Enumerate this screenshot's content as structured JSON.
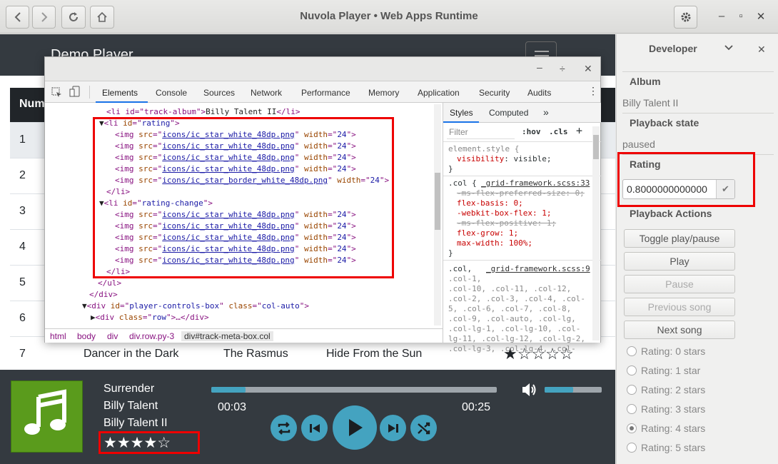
{
  "window": {
    "title": "Nuvola Player • Web Apps Runtime"
  },
  "app": {
    "brand": "Demo Player",
    "table": {
      "header": "Num",
      "rows": [
        {
          "num": "1",
          "song": "",
          "artist": "",
          "album": "",
          "stars": "",
          "selected": true
        },
        {
          "num": "2",
          "song": "",
          "artist": "",
          "album": "",
          "stars": ""
        },
        {
          "num": "3",
          "song": "",
          "artist": "",
          "album": "",
          "stars": ""
        },
        {
          "num": "4",
          "song": "",
          "artist": "",
          "album": "",
          "stars": ""
        },
        {
          "num": "5",
          "song": "",
          "artist": "",
          "album": "",
          "stars": ""
        },
        {
          "num": "6",
          "song": "",
          "artist": "",
          "album": "",
          "stars": ""
        },
        {
          "num": "7",
          "song": "Dancer in the Dark",
          "artist": "The Rasmus",
          "album": "Hide From the Sun",
          "stars": "★☆☆☆☆"
        }
      ]
    },
    "player": {
      "title": "Surrender",
      "artist": "Billy Talent",
      "album": "Billy Talent II",
      "stars": "★★★★☆",
      "elapsed": "00:03",
      "duration": "00:25",
      "progress": 0.12,
      "volume": 0.5
    }
  },
  "devtools": {
    "tabs": [
      "Elements",
      "Console",
      "Sources",
      "Network",
      "Performance",
      "Memory",
      "Application",
      "Security",
      "Audits"
    ],
    "active_tab": "Elements",
    "style_tabs": [
      "Styles",
      "Computed",
      "»"
    ],
    "filter_placeholder": "Filter",
    "hov": ":hov",
    "cls": ".cls",
    "breadcrumbs": [
      "html",
      "body",
      "div",
      "div.row.py-3",
      "div#track-meta-box.col"
    ],
    "dom": {
      "track_album_open": "<li id=\"track-album\">",
      "track_album_text": "Billy Talent II",
      "track_album_close": "</li>",
      "rating_open_id": "rating",
      "rating_change_id": "rating-change",
      "img_src_full": "icons/ic_star_white_48dp.png",
      "img_src_border": "icons/ic_star_border_white_48dp.png",
      "width": "24",
      "li_close": "</li>",
      "ul_close": "</ul>",
      "div_close": "</div>",
      "player_controls_id": "player-controls-box",
      "player_controls_class": "col-auto",
      "row_class": "row"
    },
    "styles": {
      "element_style": "element.style {",
      "visibility": "visibility: visible;",
      "close": "}",
      "col_selector": ".col {",
      "col_source": "_grid-framework.scss:33",
      "props": [
        "-ms-flex-preferred-size: 0;",
        "flex-basis: 0;",
        "-webkit-box-flex: 1;",
        "-ms-flex-positive: 1;",
        "flex-grow: 1;",
        "max-width: 100%;"
      ],
      "col2_selector": ".col,",
      "col2_source": "_grid-framework.scss:9",
      "col2_list": [
        ".col-1,",
        ".col-10, .col-11, .col-12,",
        ".col-2, .col-3, .col-4, .col-",
        "5, .col-6, .col-7, .col-8,",
        ".col-9, .col-auto, .col-lg,",
        ".col-lg-1, .col-lg-10, .col-",
        "lg-11, .col-lg-12, .col-lg-2,",
        ".col-lg-3, .col-lg-4, .col-"
      ]
    }
  },
  "sidebar": {
    "title": "Developer",
    "album_label": "Album",
    "album_value": "Billy Talent II",
    "playback_state_label": "Playback state",
    "playback_state_value": "paused",
    "rating_label": "Rating",
    "rating_value": "0.8000000000000",
    "actions_label": "Playback Actions",
    "buttons": [
      {
        "label": "Toggle play/pause",
        "disabled": false
      },
      {
        "label": "Play",
        "disabled": false
      },
      {
        "label": "Pause",
        "disabled": true
      },
      {
        "label": "Previous song",
        "disabled": true
      },
      {
        "label": "Next song",
        "disabled": false
      }
    ],
    "ratings": [
      {
        "label": "Rating: 0 stars",
        "checked": false
      },
      {
        "label": "Rating: 1 star",
        "checked": false
      },
      {
        "label": "Rating: 2 stars",
        "checked": false
      },
      {
        "label": "Rating: 3 stars",
        "checked": false
      },
      {
        "label": "Rating: 4 stars",
        "checked": true
      },
      {
        "label": "Rating: 5 stars",
        "checked": false
      }
    ]
  },
  "colors": {
    "accent": "#44a3c0",
    "dark": "#343a40",
    "highlight": "#e00000",
    "album_art": "#5a9b1c"
  }
}
